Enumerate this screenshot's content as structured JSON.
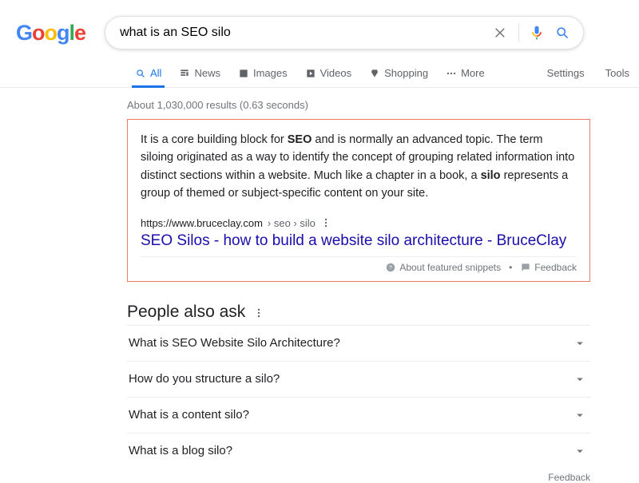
{
  "logo_chars": [
    "G",
    "o",
    "o",
    "g",
    "l",
    "e"
  ],
  "search": {
    "query": "what is an SEO silo",
    "placeholder": ""
  },
  "tabs": {
    "all": "All",
    "news": "News",
    "images": "Images",
    "videos": "Videos",
    "shopping": "Shopping",
    "more": "More",
    "settings": "Settings",
    "tools": "Tools"
  },
  "stats": "About 1,030,000 results (0.63 seconds)",
  "snippet": {
    "pre": "It is a core building block for ",
    "bold1": "SEO",
    "mid": " and is normally an advanced topic. The term siloing originated as a way to identify the concept of grouping related information into distinct sections within a website. Much like a chapter in a book, a ",
    "bold2": "silo",
    "post": " represents a group of themed or subject-specific content on your site."
  },
  "cite": {
    "domain": "https://www.bruceclay.com",
    "path": " › seo › silo"
  },
  "result_title": "SEO Silos - how to build a website silo architecture - BruceClay",
  "footer": {
    "about": "About featured snippets",
    "feedback": "Feedback"
  },
  "paa": {
    "heading": "People also ask",
    "items": [
      "What is SEO Website Silo Architecture?",
      "How do you structure a silo?",
      "What is a content silo?",
      "What is a blog silo?"
    ],
    "feedback": "Feedback"
  }
}
